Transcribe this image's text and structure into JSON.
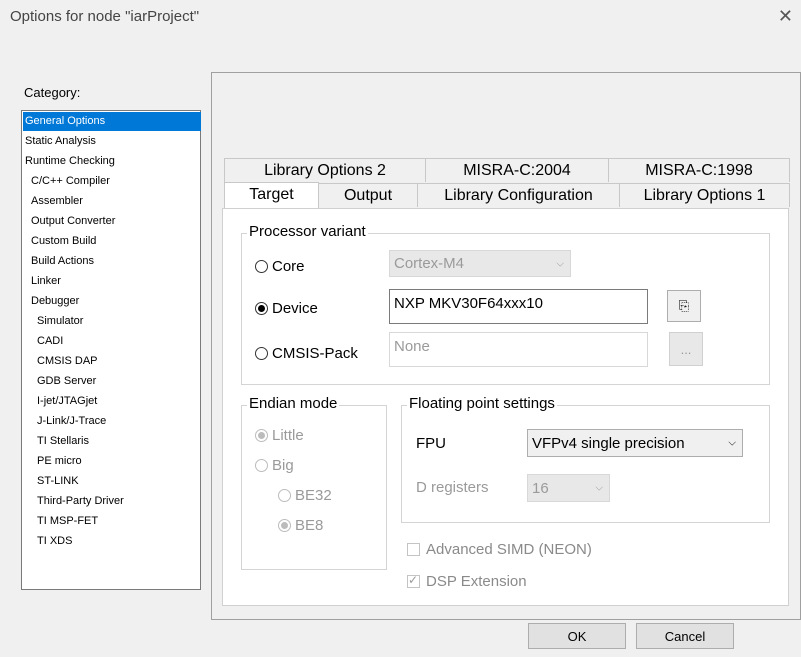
{
  "window": {
    "title": "Options for node \"iarProject\""
  },
  "sidebar": {
    "label": "Category:",
    "items": [
      {
        "label": "General Options"
      },
      {
        "label": "Static Analysis"
      },
      {
        "label": "Runtime Checking"
      },
      {
        "label": "C/C++ Compiler"
      },
      {
        "label": "Assembler"
      },
      {
        "label": "Output Converter"
      },
      {
        "label": "Custom Build"
      },
      {
        "label": "Build Actions"
      },
      {
        "label": "Linker"
      },
      {
        "label": "Debugger"
      },
      {
        "label": "Simulator"
      },
      {
        "label": "CADI"
      },
      {
        "label": "CMSIS DAP"
      },
      {
        "label": "GDB Server"
      },
      {
        "label": "I-jet/JTAGjet"
      },
      {
        "label": "J-Link/J-Trace"
      },
      {
        "label": "TI Stellaris"
      },
      {
        "label": "PE micro"
      },
      {
        "label": "ST-LINK"
      },
      {
        "label": "Third-Party Driver"
      },
      {
        "label": "TI MSP-FET"
      },
      {
        "label": "TI XDS"
      }
    ]
  },
  "tabs": {
    "row1": [
      "Library Options 2",
      "MISRA-C:2004",
      "MISRA-C:1998"
    ],
    "row2": [
      "Target",
      "Output",
      "Library Configuration",
      "Library Options 1"
    ],
    "active": "Target"
  },
  "processor": {
    "group_label": "Processor variant",
    "core_label": "Core",
    "core_value": "Cortex-M4",
    "device_label": "Device",
    "device_value": "NXP MKV30F64xxx10",
    "cmsis_label": "CMSIS-Pack",
    "cmsis_value": "None",
    "browse_label": "..."
  },
  "endian": {
    "group_label": "Endian mode",
    "little": "Little",
    "big": "Big",
    "be32": "BE32",
    "be8": "BE8"
  },
  "fpu": {
    "group_label": "Floating point settings",
    "fpu_label": "FPU",
    "fpu_value": "VFPv4 single precision",
    "dreg_label": "D registers",
    "dreg_value": "16"
  },
  "options": {
    "simd": "Advanced SIMD (NEON)",
    "dsp": "DSP Extension"
  },
  "buttons": {
    "ok": "OK",
    "cancel": "Cancel"
  }
}
